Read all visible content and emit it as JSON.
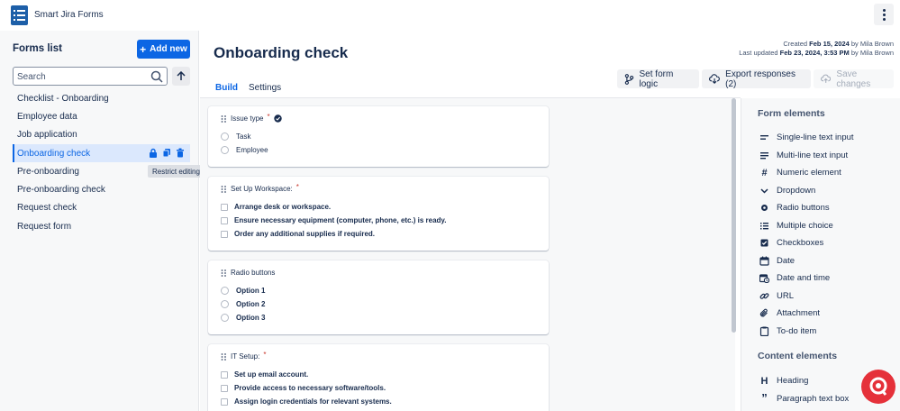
{
  "app": {
    "title": "Smart Jira Forms"
  },
  "sidebar": {
    "title": "Forms list",
    "add_button": "Add new",
    "search_placeholder": "Search",
    "items": [
      {
        "label": "Checklist - Onboarding"
      },
      {
        "label": "Employee data"
      },
      {
        "label": "Job application"
      },
      {
        "label": "Onboarding check"
      },
      {
        "label": "Pre-onboarding"
      },
      {
        "label": "Pre-onboarding check"
      },
      {
        "label": "Request check"
      },
      {
        "label": "Request form"
      }
    ],
    "tooltip": "Restrict editing and viewing of the form"
  },
  "main": {
    "title": "Onboarding check",
    "meta": {
      "created_prefix": "Created",
      "created_date": "Feb 15, 2024",
      "created_by": "by Mila Brown",
      "updated_prefix": "Last updated",
      "updated_date": "Feb 23, 2024, 3:53 PM",
      "updated_by": "by Mila Brown"
    },
    "toolbar": {
      "logic": "Set form logic",
      "export": "Export responses (2)",
      "save": "Save changes"
    },
    "tabs": [
      "Build",
      "Settings"
    ],
    "cards": [
      {
        "title": "Issue type",
        "options": [
          "Task",
          "Employee"
        ]
      },
      {
        "title": "Set Up Workspace:",
        "options": [
          "Arrange desk or workspace.",
          "Ensure necessary equipment (computer, phone, etc.) is ready.",
          "Order any additional supplies if required."
        ]
      },
      {
        "title": "Radio buttons",
        "options": [
          "Option 1",
          "Option 2",
          "Option 3"
        ]
      },
      {
        "title": "IT Setup:",
        "options": [
          "Set up email account.",
          "Provide access to necessary software/tools.",
          "Assign login credentials for relevant systems."
        ]
      }
    ]
  },
  "panel": {
    "form_elements_title": "Form elements",
    "form_elements": [
      "Single-line text input",
      "Multi-line text input",
      "Numeric element",
      "Dropdown",
      "Radio buttons",
      "Multiple choice",
      "Checkboxes",
      "Date",
      "Date and time",
      "URL",
      "Attachment",
      "To-do item"
    ],
    "content_elements_title": "Content elements",
    "content_elements": [
      "Heading",
      "Paragraph text box"
    ]
  },
  "colors": {
    "primary": "#0c66e4",
    "required": "#c9372c",
    "help": "#e5313a"
  }
}
